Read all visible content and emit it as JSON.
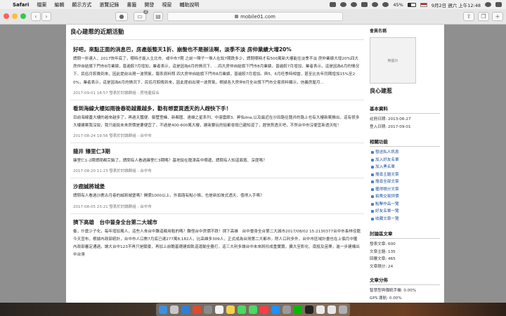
{
  "menubar": {
    "app": "Safari",
    "items": [
      "檔案",
      "編輯",
      "顯示方式",
      "瀏覽記錄",
      "書籤",
      "開發",
      "視窗",
      "輔助說明"
    ],
    "battery": "45%",
    "battery_level": 0.45,
    "datetime": "9月2日 週六 上午12:48"
  },
  "toolbar": {
    "url": "mobile01.com",
    "badge": "2",
    "back_icon": "chevron-left-icon",
    "forward_icon": "chevron-right-icon"
  },
  "main": {
    "section_title": "良心建惹的近期活動",
    "posts": [
      {
        "title": "好吧，來點正面的消息巴，房產版整天1折、崩盤也不是辦法啊，淡季不淡 房仲業績大增20%",
        "body": "請問一折達人，2017快年底了，哪時才能入主北市、或中市7期 之前一陣子一堆人在說7期跌多少，請問哪時才有500萬新大樓能住淡季不淡 房仲業績大增20%四大房仲自結旗下門市8月業績，普遍較7月增加，業者表示，這是因為6月的情況下、...四大房仲自結旗下門市8月業績，普遍較7月增加，業者表示，這是因為6月的情況下、民俗月較晚到來，因此提前出現一波買氣，報系資料照 四大房仲自結旗下門市8月業績，普遍較7月增加。與5、6月旺季時相當，甚至比去年同期增加15%至20%，業者表示，這是因為6月的情況下、民俗月較晚到來，因此提前出現一波買氣，根據各大房仲8月全台旗下門市交易資料顯示，信義房屋月...",
        "meta": "2017-09-01 18:57 發表於討論群組 - 房地產綜合"
      },
      {
        "title": "看到海線大樓如雨後春筍越蓋越多，勸有想要買透天的人趕快下手！",
        "body": "目前海線蓋大樓的越來越多了，再過天蠶便、御墅登峰、新都匯、遠雄之星系列、中港雲廊3、昇佑dna,以及最近在沙田路往龍井的路上也有大樓新案推出，這有很多大樓建案我沒說，我只能說未來房價是要便宜了，不過是400-600萬大樓，建商要玩的話都會既已趨知道了，趕快買透天吧，不然台中市沒便宜新透天啦！",
        "meta": "2017-08-24 19:56 發表於討論群組 - 台中市"
      },
      {
        "title": "龍井 臻里仁3期",
        "body": "臻里仁1-2期請問都完銷了，請問有人看過臻里仁3期嗎？基地說在龍津高中哪邊，請問有人知道面寬、深度嗎？",
        "meta": "2017-08-20 11:23 發表於討論群組 - 台中市"
      },
      {
        "title": "沙鹿誠將城堡",
        "body": "請問有人看過沙鹿古月巷的誠將城堡嗎？開價1000以上，外面路有點小條，也是新加坡式透天，值得入手嗎？",
        "meta": "2017-08-05 23:21 發表於討論群組 - 台中市"
      },
      {
        "title": "擠下高雄　台中晉身全台第二大城市",
        "body": "衝，什麼少子化，每年增加萬人，這些人來台中難道都用租的嗎？難怪台中房價不跌！擠下高雄　台中晉身全台第二大城市2017/08/02 15:2130377台中市長林佳龍今天宣布，根據內政部統計，台中市人口數7月底已達277萬8,182人，比高雄多309人，正式成為台灣第二大都市，除人口利多外，台中市區域計畫也在上個月中獲內政部審定通過，讓大台中123不再只是願景，再加上前瞻基礎建設軌道運輸全疊打，這三大利多讓台中未來將形成重實篇，擴大至彰化、南投及苗栗，進一步建構出中台灣",
        "meta": ""
      }
    ]
  },
  "sidebar": {
    "member_name_label": "會員名稱",
    "avatar_text": "無圖示",
    "username": "良心建惹",
    "basic": {
      "title": "基本資料",
      "lines": [
        "註冊日期: 2013-06-27",
        "登入日期: 2017-09-01"
      ]
    },
    "functions": {
      "title": "相關功能",
      "items": [
        "發送私人訊息",
        "加入好友名單",
        "加入黑名單",
        "搜尋主題文章",
        "搜尋全部文章",
        "獲得積分文章",
        "拍賣交易評價",
        "點擊作品一覽",
        "好友名單一覽",
        "收藏文章一覽"
      ]
    },
    "stats": {
      "title": "討論區文章",
      "lines": [
        "發表文章: 600",
        "文章主題: 135",
        "回覆文章: 465",
        "文章積分: 24"
      ]
    },
    "distribution": {
      "title": "文章分佈",
      "lines": [
        "智慧型與傳統手機: 0.00%",
        "GPS 導航: 0.00%"
      ]
    }
  },
  "colors": {
    "link": "#1a4f9c",
    "page_bg": "#ffffff",
    "backdrop": "#8f8f8f"
  }
}
